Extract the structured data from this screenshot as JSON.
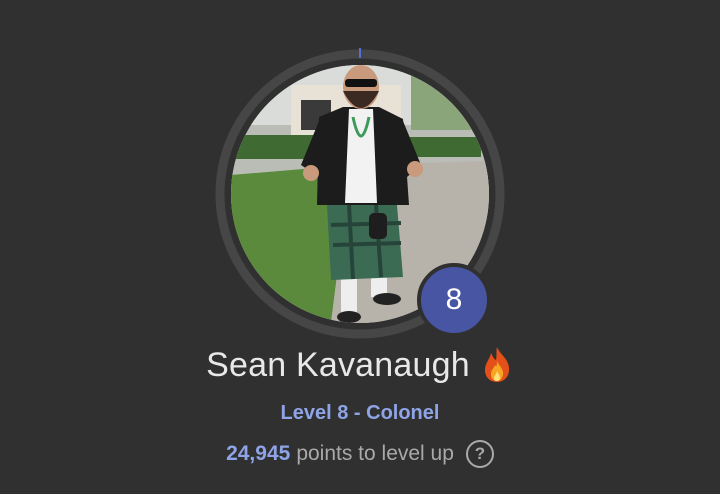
{
  "profile": {
    "name": "Sean Kavanaugh",
    "name_icon": "fire-icon",
    "avatar_icon": "user-photo",
    "level_badge": "8",
    "level_title": "Level 8 - Colonel",
    "points_value": "24,945",
    "points_label": "points to level up",
    "help_icon": "question-circle-icon",
    "help_symbol": "?",
    "level_progress": 0.0
  },
  "colors": {
    "background": "#303030",
    "accent": "#8fa4e6",
    "badge": "#4755a3",
    "ring": "#444444"
  }
}
